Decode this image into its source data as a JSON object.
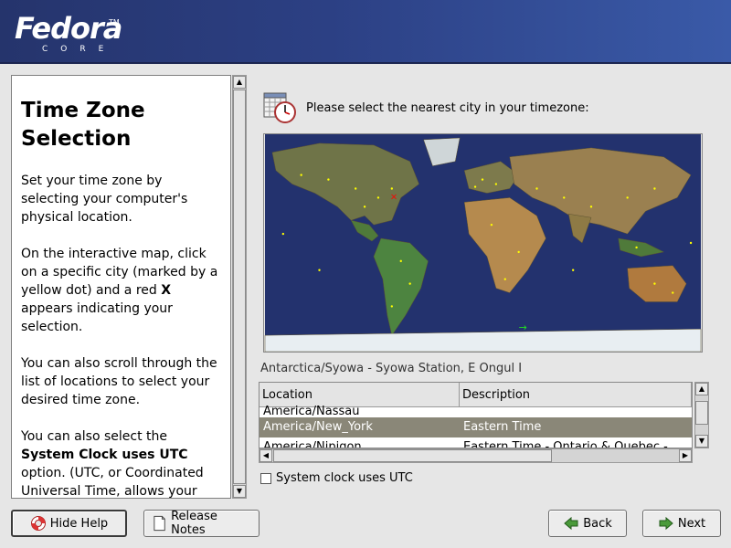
{
  "banner": {
    "logo_word": "Fedora",
    "logo_tm": "TM",
    "logo_sub": "CORE"
  },
  "help": {
    "title": "Time Zone Selection",
    "paragraphs": [
      "Set your time zone by selecting your computer's physical location.",
      "You can also scroll through the list of locations to select your desired time zone."
    ],
    "p2_part1": "On the interactive map, click on a specific city (marked by a yellow dot) and a red ",
    "p2_bold": "X",
    "p2_part2": " appears indicating your selection.",
    "p4_part1": "You can also select the ",
    "p4_bold": "System Clock uses UTC",
    "p4_part2": " option. (UTC, or Coordinated Universal Time, allows your"
  },
  "timezone": {
    "prompt": "Please select the nearest city in your timezone:",
    "selected_city": "Antarctica/Syowa - Syowa Station, E Ongul I",
    "columns": {
      "location": "Location",
      "description": "Description"
    },
    "rows": [
      {
        "location": "America/Nassau",
        "description": ""
      },
      {
        "location": "America/New_York",
        "description": "Eastern Time"
      },
      {
        "location": "America/Nipigon",
        "description": "Eastern Time - Ontario & Quebec - places"
      }
    ],
    "utc_label": "System clock uses UTC",
    "utc_checked": false
  },
  "buttons": {
    "hide_help": "Hide Help",
    "release_notes": "Release Notes",
    "back": "Back",
    "next": "Next"
  },
  "colors": {
    "banner": "#2c4084",
    "selection": "#8a8778",
    "ocean": "#23326e",
    "city_dot": "#ffff00",
    "marker": "#ff0000"
  },
  "icons": [
    "clock-calendar-icon",
    "lifebuoy-icon",
    "document-icon",
    "back-arrow-icon",
    "next-arrow-icon"
  ]
}
